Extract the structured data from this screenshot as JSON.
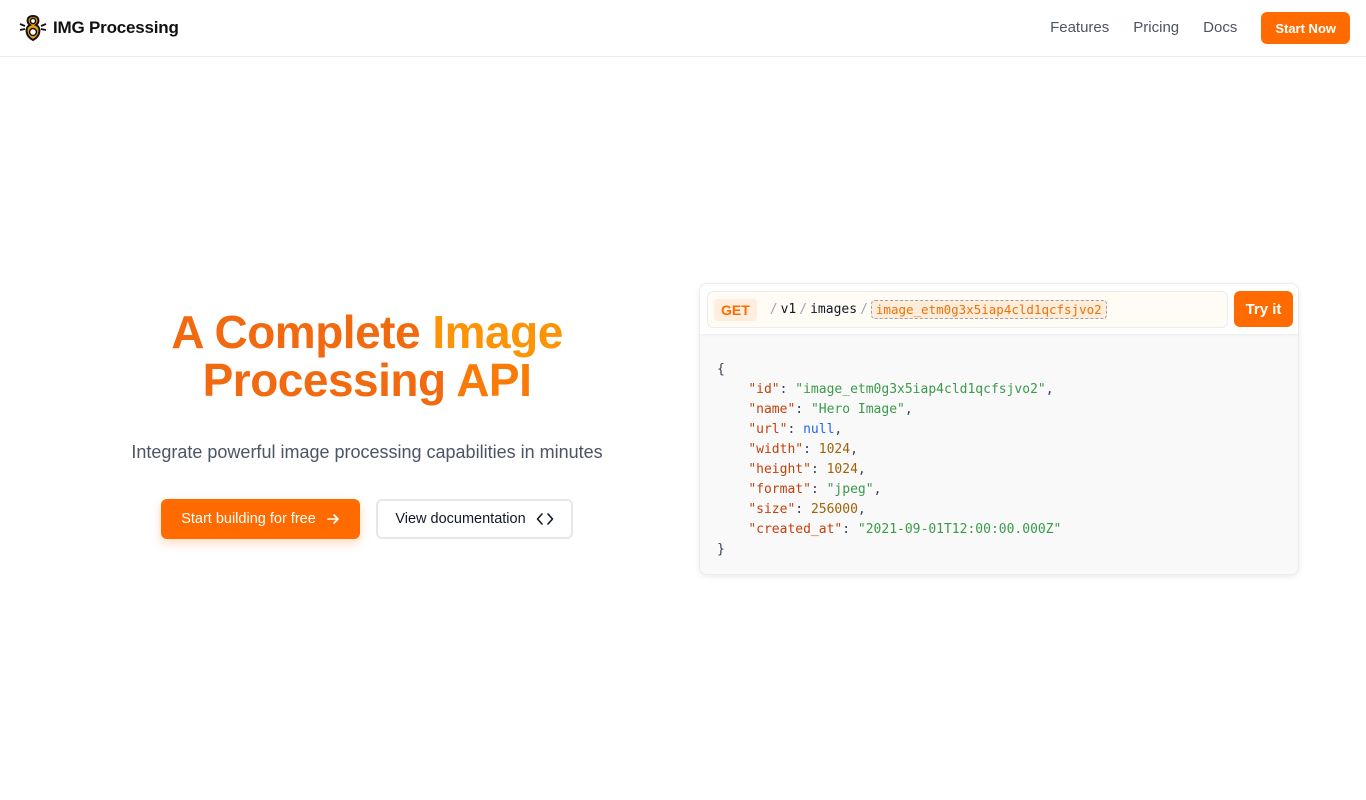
{
  "header": {
    "brand_name": "IMG Processing",
    "nav": [
      "Features",
      "Pricing",
      "Docs"
    ],
    "cta_label": "Start Now"
  },
  "hero": {
    "title_line1_a": "A Complete ",
    "title_line1_b": "Image",
    "title_line2_a": "Processing ",
    "title_line2_b": "API",
    "subtitle": "Integrate powerful image processing capabilities in minutes",
    "primary_label": "Start building for free",
    "secondary_label": "View documentation"
  },
  "api": {
    "method": "GET",
    "path_segments": [
      "v1",
      "images"
    ],
    "image_id": "image_etm0g3x5iap4cld1qcfsjvo2",
    "try_label": "Try it",
    "response": {
      "open": "{",
      "close": "}",
      "fields": [
        {
          "key": "\"id\"",
          "value": "\"image_etm0g3x5iap4cld1qcfsjvo2\"",
          "kind": "s",
          "trail": ","
        },
        {
          "key": "\"name\"",
          "value": "\"Hero Image\"",
          "kind": "s",
          "trail": ","
        },
        {
          "key": "\"url\"",
          "value": "null",
          "kind": "nl",
          "trail": ","
        },
        {
          "key": "\"width\"",
          "value": "1024",
          "kind": "n",
          "trail": ","
        },
        {
          "key": "\"height\"",
          "value": "1024",
          "kind": "n",
          "trail": ","
        },
        {
          "key": "\"format\"",
          "value": "\"jpeg\"",
          "kind": "s",
          "trail": ","
        },
        {
          "key": "\"size\"",
          "value": "256000",
          "kind": "n",
          "trail": ","
        },
        {
          "key": "\"created_at\"",
          "value": "\"2021-09-01T12:00:00.000Z\"",
          "kind": "s",
          "trail": ""
        }
      ]
    }
  },
  "colors": {
    "accent": "#ff6b00",
    "accent_light": "#fb9406"
  }
}
